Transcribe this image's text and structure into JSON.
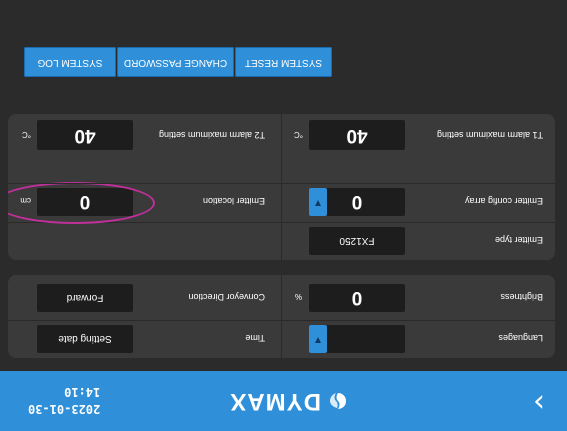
{
  "header": {
    "brand": "DYMAX",
    "date": "2023-01-30",
    "time": "14:10",
    "back_glyph": "›"
  },
  "settings": {
    "languages_label": "Languages",
    "time_label": "Time",
    "time_value": "Setting date",
    "brightness_label": "Brightness",
    "brightness_value": "0",
    "brightness_unit": "%",
    "conveyor_label": "Conveyor Direction",
    "conveyor_value": "Forward"
  },
  "emitter": {
    "type_label": "Emitter type",
    "type_value": "FX1250",
    "config_label": "Emitter config array",
    "config_value": "0",
    "location_label": "Emitter location",
    "location_value": "0",
    "location_unit": "cm"
  },
  "alarms": {
    "t1_label": "T1 alarm maximum setting",
    "t1_value": "40",
    "t1_unit": "°C",
    "t2_label": "T2 alarm maximum setting",
    "t2_value": "40",
    "t2_unit": "°C"
  },
  "buttons": {
    "system_reset": "SYSTEM RESET",
    "change_password": "CHANGE PASSWORD",
    "system_log": "SYSTEM LOG"
  },
  "colors": {
    "accent": "#2f8fd8",
    "annotation": "#c0309a"
  }
}
